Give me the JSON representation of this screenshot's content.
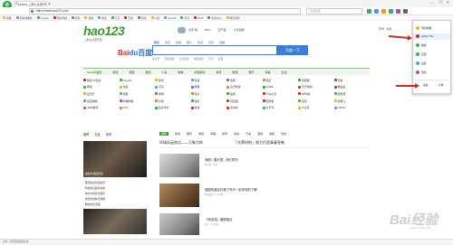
{
  "browser": {
    "logo": "e",
    "tab_title": "hao123_上网从这里开始",
    "new_tab": "+",
    "window_controls": "— ❐ ✕",
    "url": "https://www.hao123.com/",
    "search_placeholder": "百度搜索",
    "nav_icons": [
      "back-icon",
      "forward-icon",
      "refresh-icon",
      "home-icon"
    ]
  },
  "bookmarks": [
    "收藏",
    "手机收藏夹",
    "Google",
    "网址导航",
    "游戏",
    "视频",
    "淘宝",
    "京东",
    "天猫",
    "新闻",
    "小说",
    "hao123",
    "学习",
    "2345",
    "游戏中心",
    "网页游戏"
  ],
  "header": {
    "logo": "hao123",
    "logo_sub": "上网从这里开始",
    "weather_items": [
      "北京 晴",
      "22°C",
      "空气良",
      "今日运势"
    ],
    "user_links": "登录 · 换肤"
  },
  "search": {
    "baidu_a": "Bai",
    "baidu_b": "du百度",
    "tabs": [
      "网页",
      "资讯",
      "视频",
      "图片",
      "知道",
      "音乐",
      "地图"
    ],
    "button": "百度一下",
    "hot_words": [
      "爱奇艺",
      "百度热搜",
      "今日头条",
      "淘宝特卖",
      "京东",
      "天猫"
    ]
  },
  "site_nav": [
    "hao123首页",
    "新闻",
    "视频",
    "游戏",
    "小说",
    "购物",
    "中国新闻",
    "体育",
    "财经",
    "娱乐",
    "军事",
    "生活"
  ],
  "sites": [
    [
      "网易·方百合",
      "hao123",
      "腾讯",
      "新浪",
      "搜狐",
      "百度",
      "凤凰网",
      "天猫"
    ],
    [
      "网易",
      "淘宝",
      "京东",
      "携程",
      "东方财富",
      "12306",
      "苏宁易购",
      "唯品会"
    ],
    [
      "爱奇艺",
      "优酷",
      "微博",
      "知乎",
      "贴吧",
      "汽车之家",
      "58同城",
      "赶集网"
    ],
    [
      "百度地图",
      "哔哩哔哩",
      "抖音",
      "快手",
      "同花顺",
      "安居客",
      "链家",
      "去哪儿"
    ],
    [
      "4399游戏",
      "7k7k",
      "起点中文",
      "纵横",
      "中关村",
      "太平洋",
      "IT之家",
      "CSDN"
    ]
  ],
  "left_news": {
    "tabs": [
      "推荐",
      "社会",
      "体育"
    ],
    "photo_caption": "美丽乡村展览馆",
    "items": [
      "聚焦热点新闻资讯",
      "科技前沿最新动态",
      "地方文旅风光展示",
      "财经市场每日观察",
      "网友热议话题"
    ]
  },
  "center_news": {
    "tabs": [
      "推荐",
      "新闻",
      "娱乐",
      "财经",
      "军事",
      "体育",
      "科技",
      "汽车",
      "游戏",
      "健康",
      "历史"
    ],
    "headline": "环球风云热点——万象为你",
    "headline2": "「光荣时刻」努力打造青春答卷",
    "subheadline": "海外连线：青年奋斗故事集",
    "items": [
      {
        "title": "海报丨春天里，我们同行",
        "meta": "新华社 · 今天"
      },
      {
        "title": "搜狐知道这件事了吗不一定你真的了解",
        "meta": "科技频道 · 1小时前"
      },
      {
        "title": "「网评线」最新观点",
        "meta": "评论 · 2小时前"
      }
    ]
  },
  "menu": {
    "items": [
      "添加收藏",
      "edition Plu...",
      "播放",
      "应用",
      "设置",
      "帮助"
    ],
    "bottom_left": "缩放",
    "bottom_right": "全屏"
  },
  "status": "完成 · 当前页面加载完成",
  "watermark": "Bai经验",
  "watermark_sub": "jingyan.baidu.com",
  "colors": {
    "brand_green": "#3c9a2e",
    "baidu_blue": "#3a7fd6",
    "arrow_red": "#d7281d"
  }
}
